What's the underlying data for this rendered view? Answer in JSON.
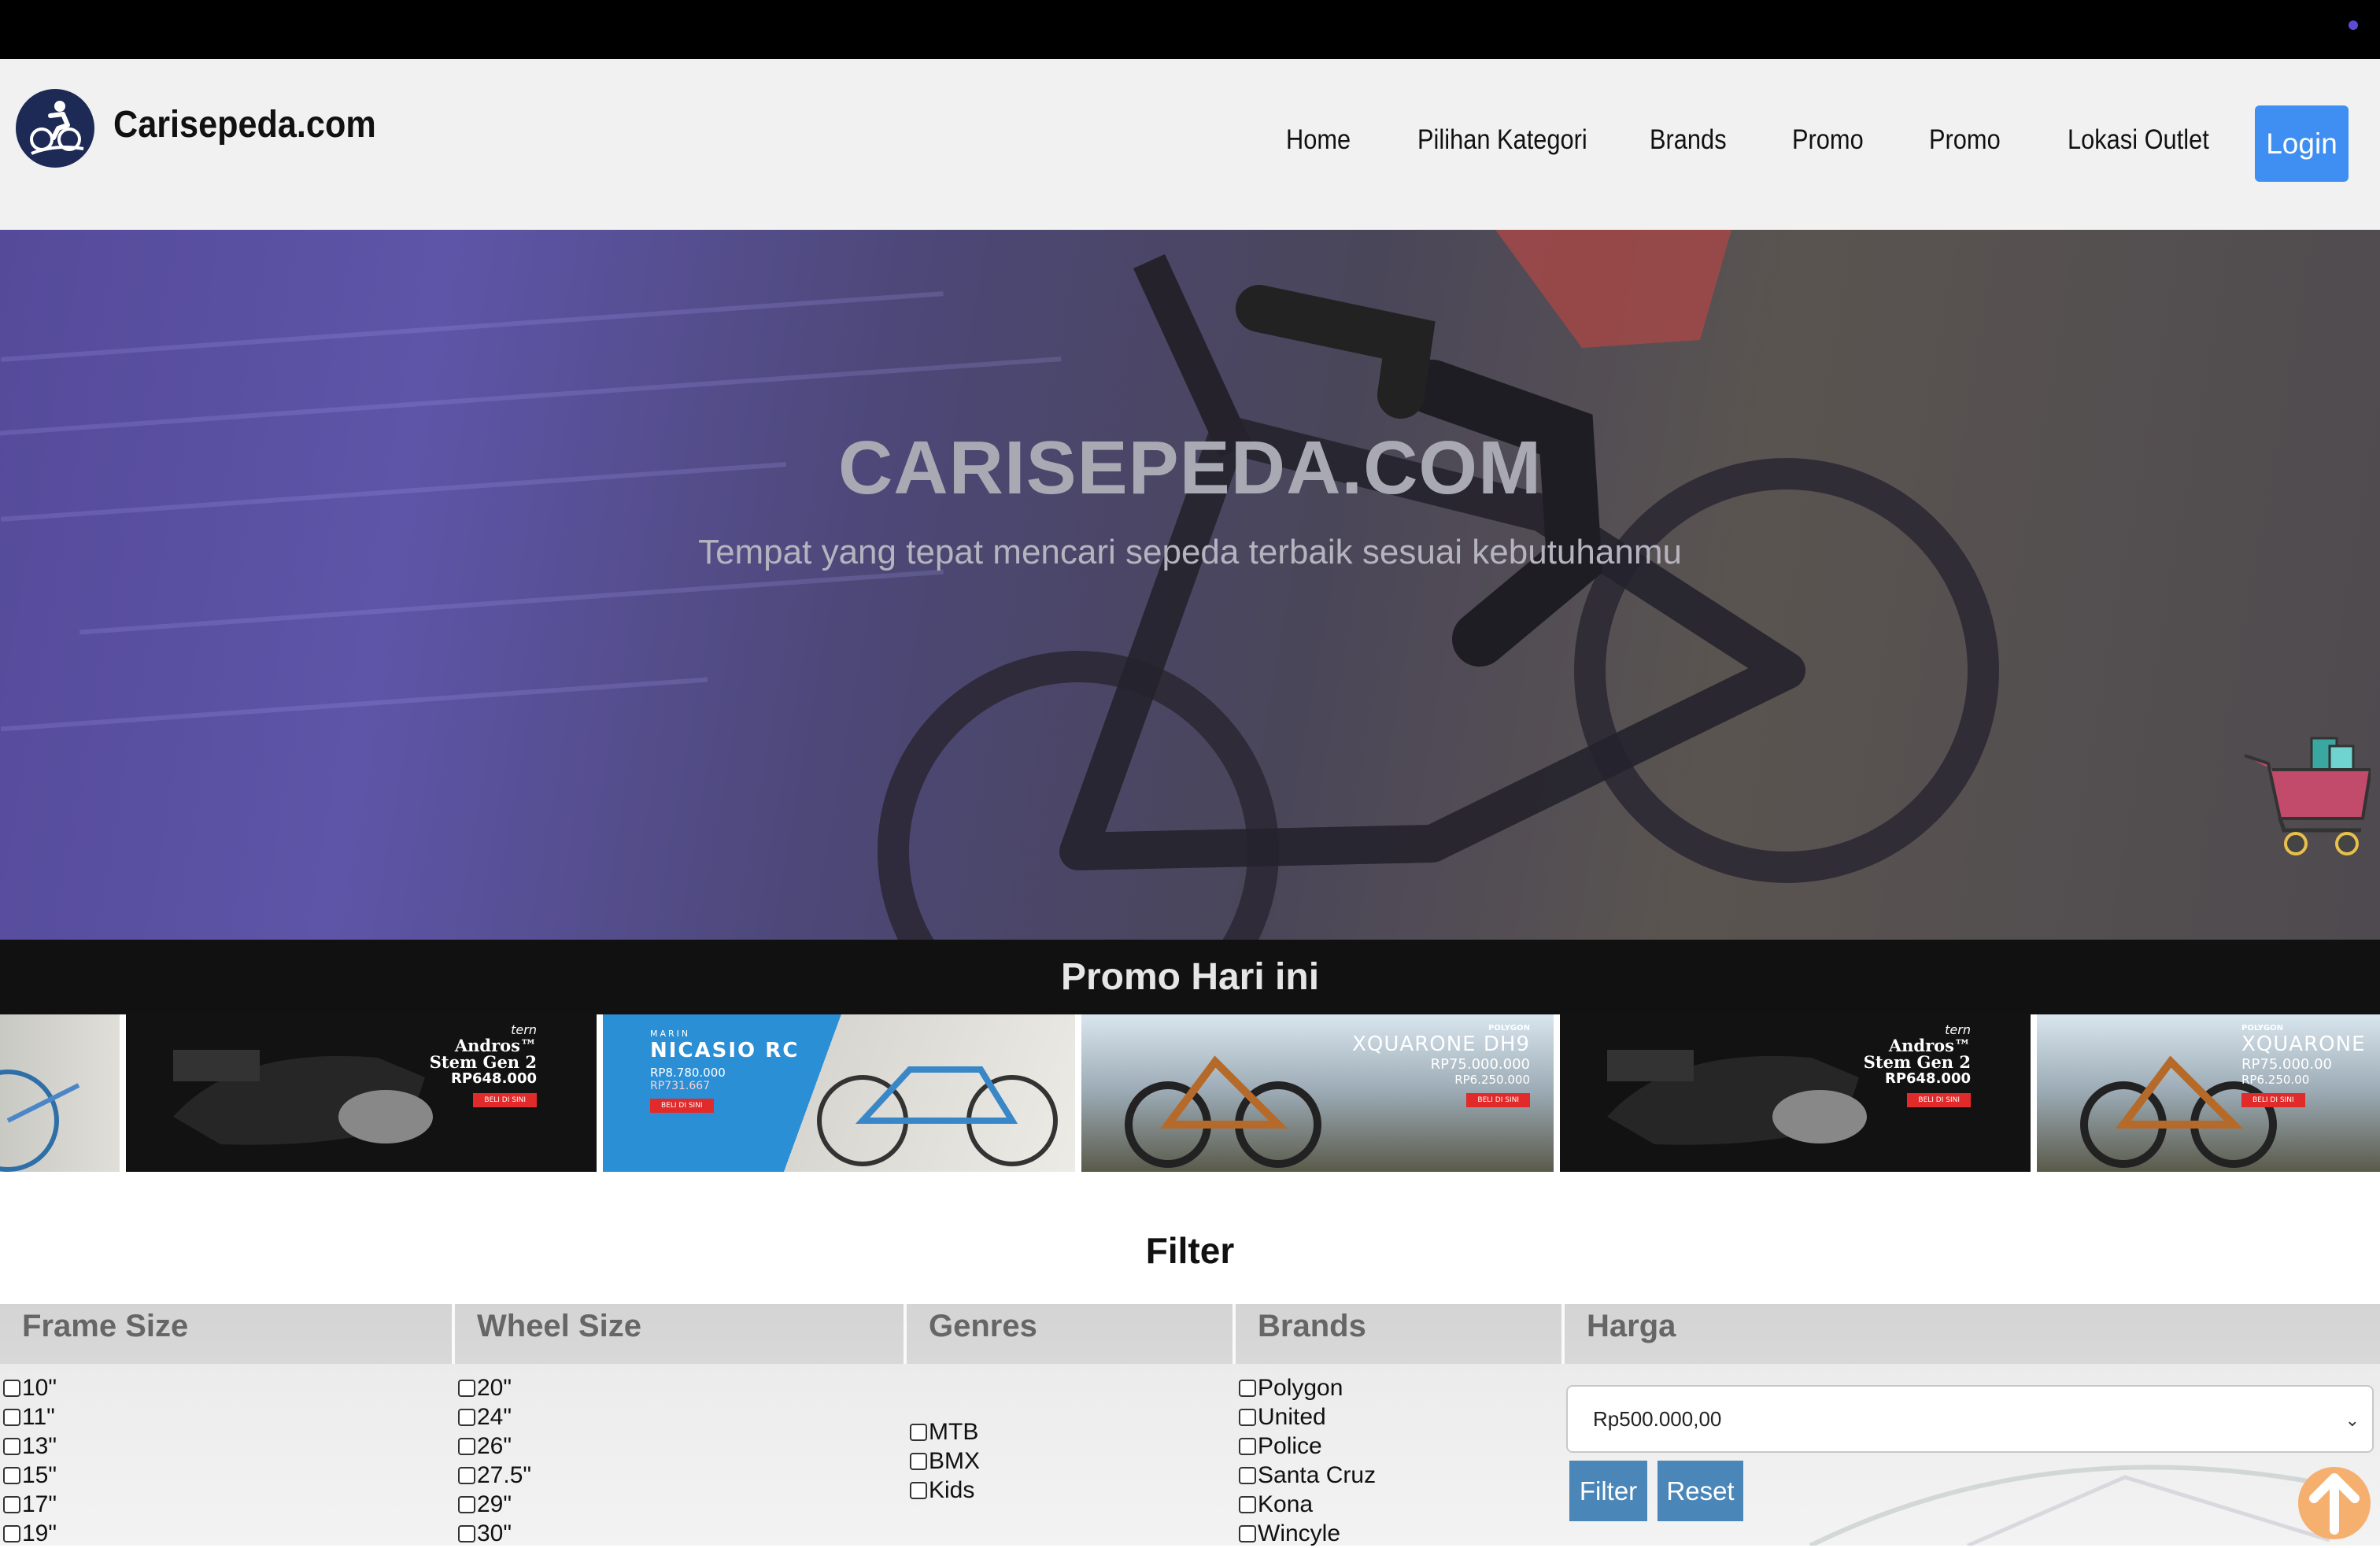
{
  "topbar": {
    "accent": "#5b4cd6"
  },
  "header": {
    "brand": "Carisepeda.com",
    "logo_icon": "cyclist-logo-icon",
    "nav": [
      {
        "label": "Home"
      },
      {
        "label": "Pilihan Kategori"
      },
      {
        "label": "Brands"
      },
      {
        "label": "Promo"
      },
      {
        "label": "Promo"
      },
      {
        "label": "Lokasi Outlet"
      }
    ],
    "login_label": "Login",
    "login_color": "#3f8ff2"
  },
  "hero": {
    "title": "CARISEPEDA.COM",
    "subtitle": "Tempat yang tepat mencari sepeda terbaik sesuai kebutuhanmu",
    "cart_icon": "shopping-cart-icon"
  },
  "promo": {
    "title": "Promo Hari ini",
    "slides": [
      {
        "brand": "",
        "name": "",
        "price": "",
        "price2": "",
        "cta": ""
      },
      {
        "brand": "tern",
        "name": "Andros™ Stem Gen 2",
        "price": "RP648.000",
        "price2": "",
        "cta": "BELI DI SINI"
      },
      {
        "brand": "MARIN",
        "name": "NICASIO RC",
        "price": "RP8.780.000",
        "price2": "RP731.667",
        "cta": "BELI DI SINI"
      },
      {
        "brand": "POLYGON",
        "name": "XQUARONE DH9",
        "price": "RP75.000.000",
        "price2": "RP6.250.000",
        "cta": "BELI DI SINI"
      },
      {
        "brand": "tern",
        "name": "Andros™ Stem Gen 2",
        "price": "RP648.000",
        "price2": "",
        "cta": "BELI DI SINI"
      },
      {
        "brand": "POLYGON",
        "name": "XQUARONE",
        "price": "RP75.000.00",
        "price2": "RP6.250.00",
        "cta": "BELI DI SINI"
      }
    ]
  },
  "filter": {
    "heading": "Filter",
    "columns": {
      "frame_size": {
        "label": "Frame Size",
        "options": [
          "10\"",
          "11\"",
          "13\"",
          "15\"",
          "17\"",
          "19\""
        ]
      },
      "wheel_size": {
        "label": "Wheel Size",
        "options": [
          "20\"",
          "24\"",
          "26\"",
          "27.5\"",
          "29\"",
          "30\""
        ]
      },
      "genres": {
        "label": "Genres",
        "options": [
          "MTB",
          "BMX",
          "Kids"
        ]
      },
      "brands": {
        "label": "Brands",
        "options": [
          "Polygon",
          "United",
          "Police",
          "Santa Cruz",
          "Kona",
          "Wincyle"
        ]
      },
      "harga": {
        "label": "Harga",
        "selected": "Rp500.000,00"
      }
    },
    "filter_button": "Filter",
    "reset_button": "Reset"
  },
  "scroll_top_icon": "arrow-up-icon"
}
